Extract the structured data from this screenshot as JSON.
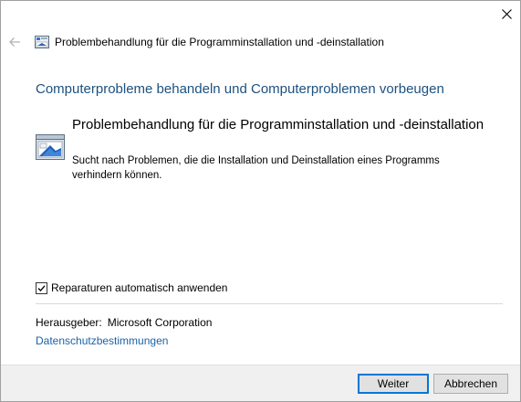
{
  "window": {
    "title": "Problembehandlung für die Programminstallation und -deinstallation",
    "close_icon": "close-icon",
    "back_icon": "back-arrow-icon"
  },
  "main": {
    "heading": "Computerprobleme behandeln und Computerproblemen vorbeugen",
    "troubleshooter": {
      "icon": "program-install-troubleshooter-icon",
      "title": "Problembehandlung für die Programminstallation und -deinstallation",
      "description": "Sucht nach Problemen, die die Installation und Deinstallation eines Programms verhindern können."
    },
    "auto_repair": {
      "label": "Reparaturen automatisch anwenden",
      "checked": true
    },
    "publisher": {
      "label": "Herausgeber:",
      "value": "Microsoft Corporation"
    },
    "privacy_link": "Datenschutzbestimmungen"
  },
  "footer": {
    "next_label": "Weiter",
    "cancel_label": "Abbrechen"
  },
  "colors": {
    "heading_blue": "#1c5180",
    "link_blue": "#1a63a8",
    "focus_blue": "#0078d7",
    "footer_bg": "#f0f0f0"
  }
}
